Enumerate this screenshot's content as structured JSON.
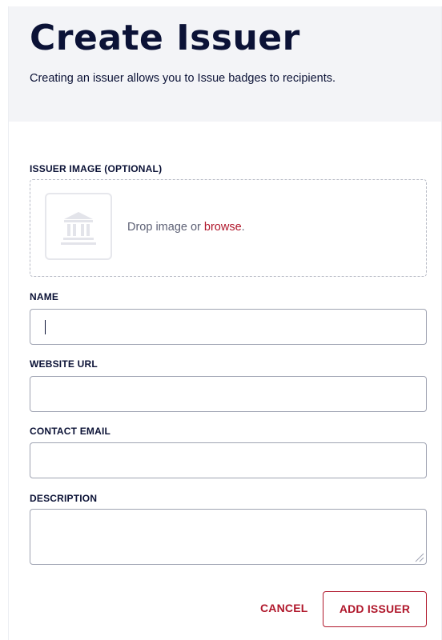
{
  "header": {
    "title": "Create Issuer",
    "subtitle": "Creating an issuer allows you to Issue badges to recipients."
  },
  "image_upload": {
    "label": "ISSUER IMAGE (OPTIONAL)",
    "drop_text": "Drop image or ",
    "browse_link": "browse",
    "period": ".",
    "placeholder_icon": "institution-icon"
  },
  "fields": {
    "name": {
      "label": "NAME",
      "value": ""
    },
    "website": {
      "label": "WEBSITE URL",
      "value": ""
    },
    "email": {
      "label": "CONTACT EMAIL",
      "value": ""
    },
    "description": {
      "label": "DESCRIPTION",
      "value": ""
    }
  },
  "actions": {
    "cancel_label": "CANCEL",
    "add_label": "ADD ISSUER"
  },
  "colors": {
    "title": "#0b1236",
    "accent": "#b0172b",
    "header_bg": "#f3f4f7"
  }
}
